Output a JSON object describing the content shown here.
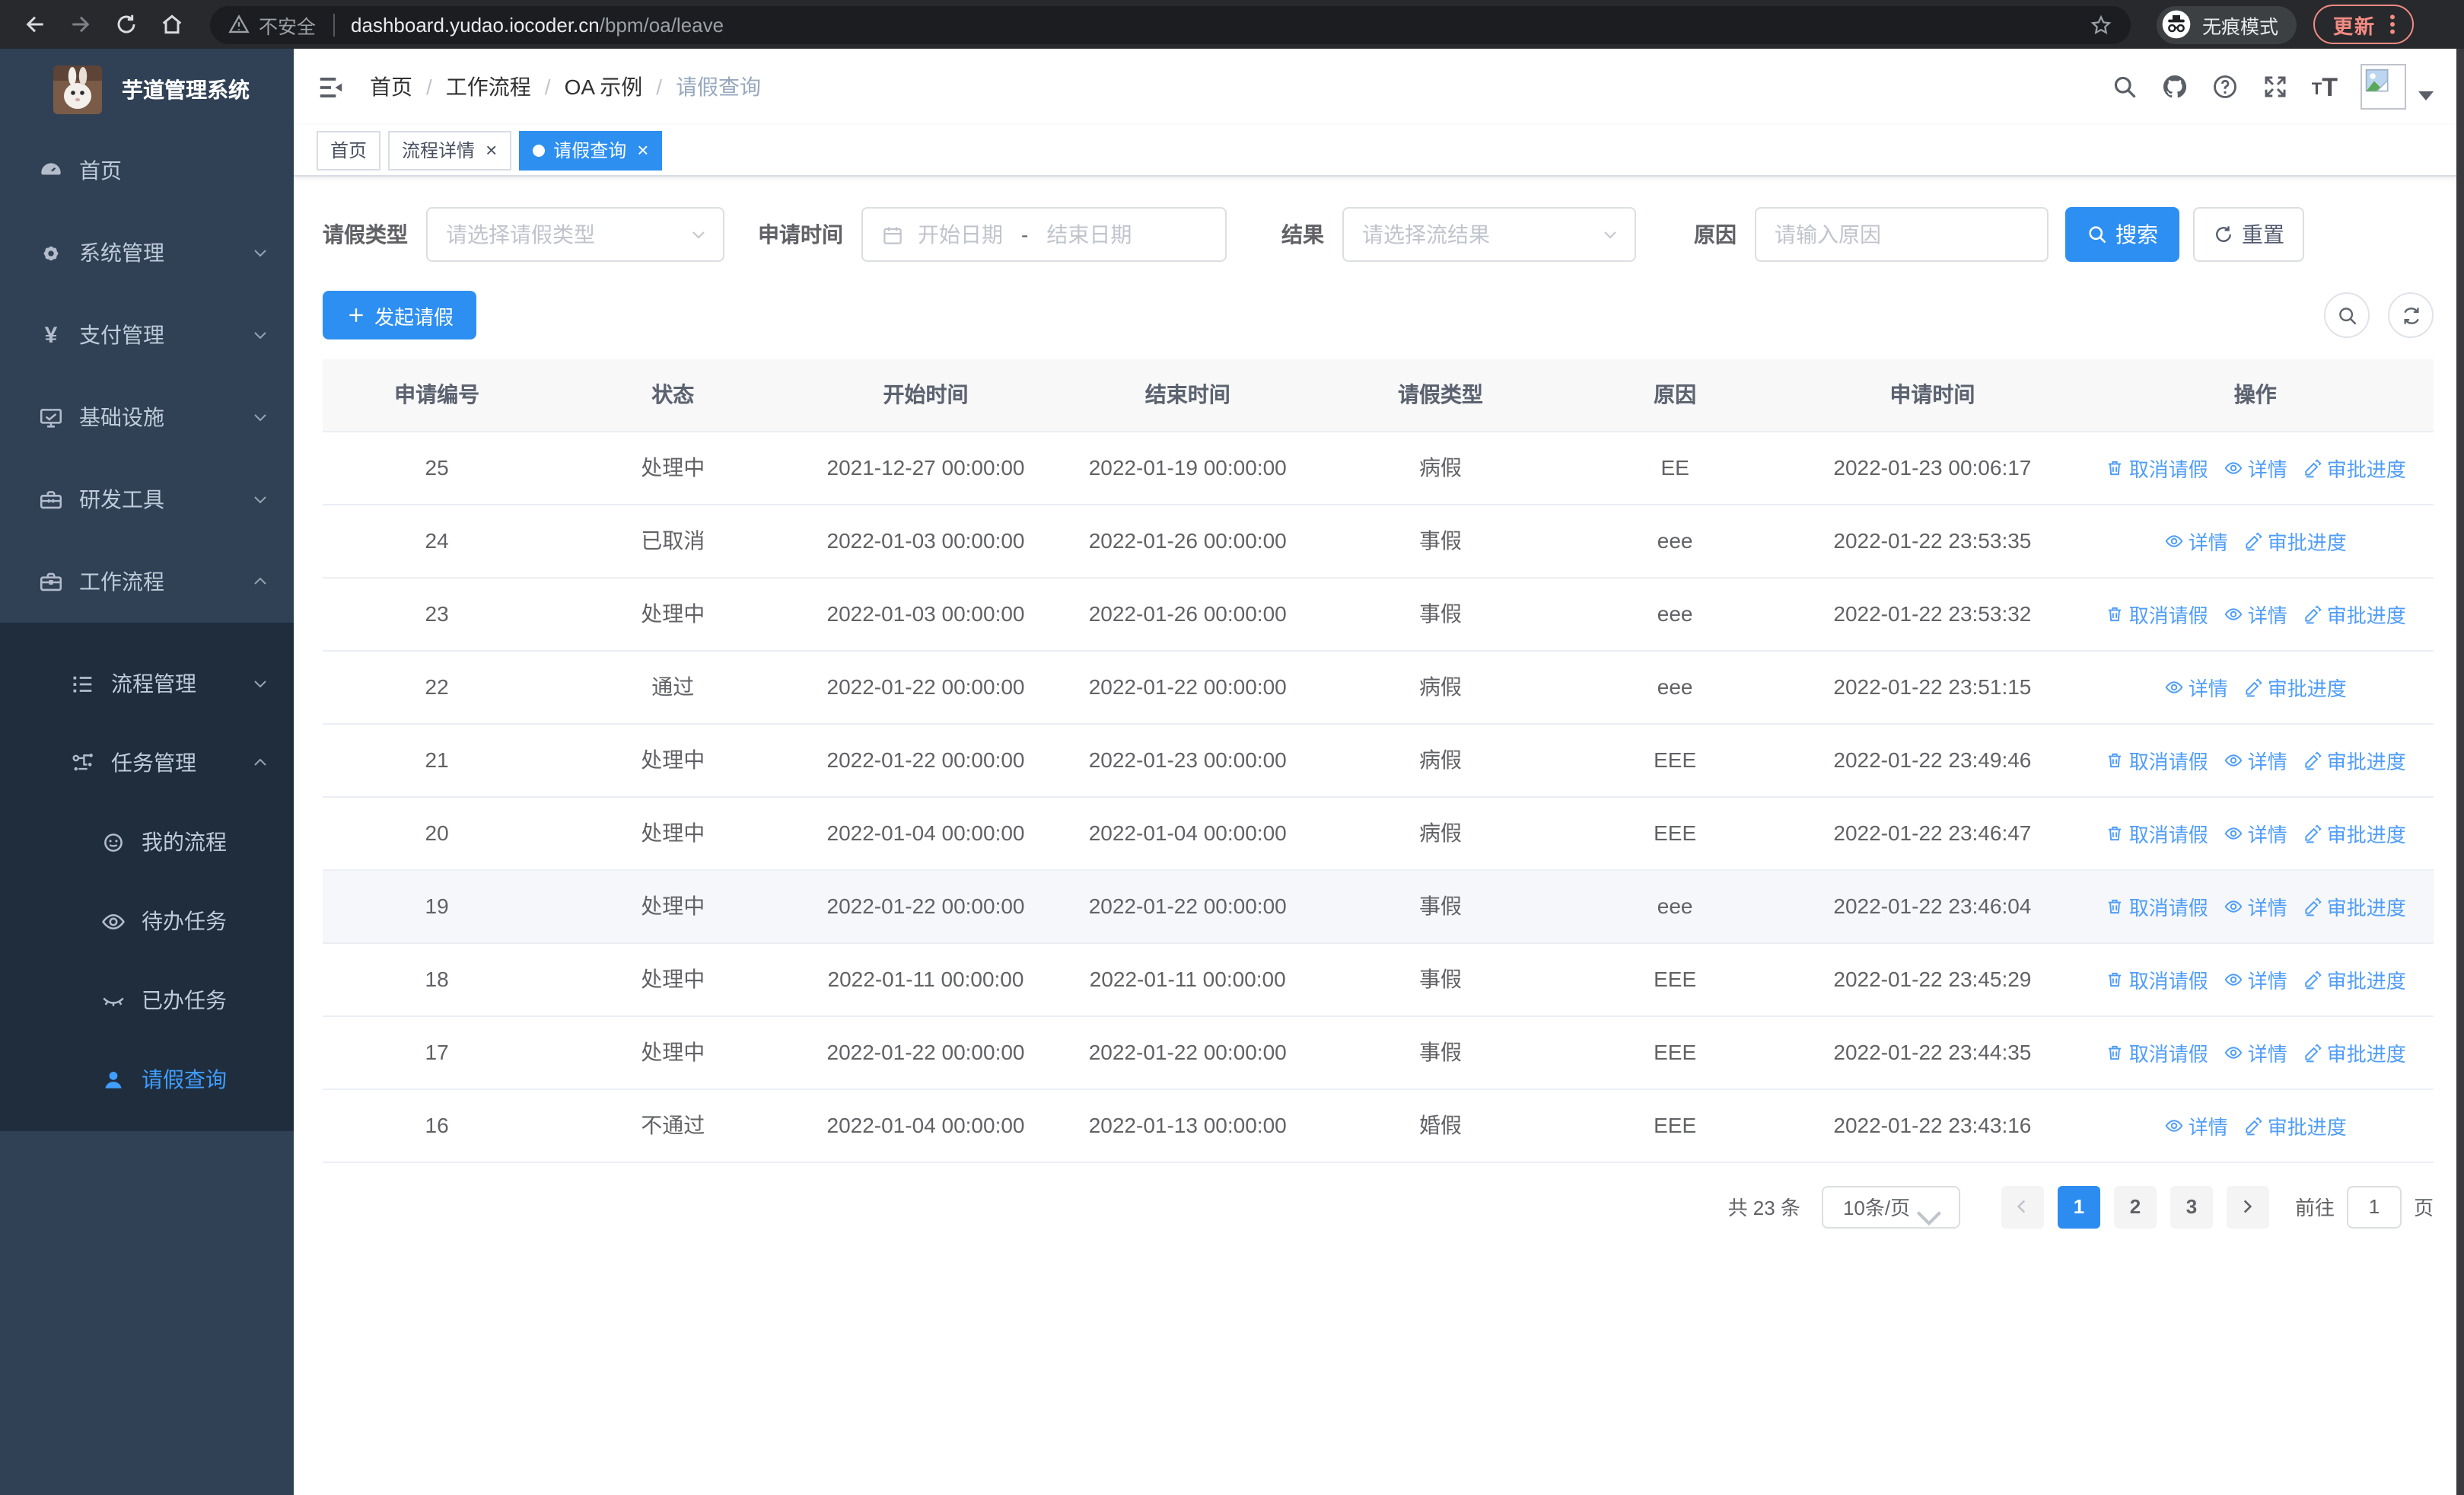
{
  "colors": {
    "primary": "#2d8ff0",
    "link": "#4f9df8",
    "sidebar_bg": "#304156",
    "sidebar_submenu_bg": "#1f2d3d",
    "sidebar_active": "#409eff"
  },
  "browser": {
    "security_label": "不安全",
    "url_host": "dashboard.yudao.iocoder.cn",
    "url_path": "/bpm/oa/leave",
    "incognito_label": "无痕模式",
    "update_label": "更新"
  },
  "sidebar": {
    "title": "芋道管理系统",
    "items": [
      {
        "label": "首页"
      },
      {
        "label": "系统管理"
      },
      {
        "label": "支付管理"
      },
      {
        "label": "基础设施"
      },
      {
        "label": "研发工具"
      },
      {
        "label": "工作流程"
      }
    ],
    "submenu": [
      {
        "label": "流程管理"
      },
      {
        "label": "任务管理"
      },
      {
        "label": "我的流程"
      },
      {
        "label": "待办任务"
      },
      {
        "label": "已办任务"
      },
      {
        "label": "请假查询"
      }
    ]
  },
  "header": {
    "breadcrumb": [
      "首页",
      "工作流程",
      "OA 示例",
      "请假查询"
    ],
    "separator": "/"
  },
  "tabs": {
    "close_glyph": "×",
    "items": [
      {
        "label": "首页"
      },
      {
        "label": "流程详情"
      },
      {
        "label": "请假查询"
      }
    ]
  },
  "filters": {
    "leave_type": {
      "label": "请假类型",
      "placeholder": "请选择请假类型"
    },
    "apply_time": {
      "label": "申请时间",
      "start_placeholder": "开始日期",
      "separator": "-",
      "end_placeholder": "结束日期"
    },
    "result": {
      "label": "结果",
      "placeholder": "请选择流结果"
    },
    "reason": {
      "label": "原因",
      "placeholder": "请输入原因"
    },
    "search_label": "搜索",
    "reset_label": "重置"
  },
  "toolbar": {
    "create_label": "发起请假"
  },
  "table": {
    "columns": [
      "申请编号",
      "状态",
      "开始时间",
      "结束时间",
      "请假类型",
      "原因",
      "申请时间",
      "操作"
    ],
    "column_keys": [
      "id",
      "status",
      "start",
      "end",
      "type",
      "reason",
      "applied"
    ],
    "actions_meta": {
      "cancel": {
        "label": "取消请假",
        "icon": "trash-icon"
      },
      "detail": {
        "label": "详情",
        "icon": "eye-icon"
      },
      "progress": {
        "label": "审批进度",
        "icon": "pen-icon"
      }
    },
    "rows": [
      {
        "id": "25",
        "status": "处理中",
        "start": "2021-12-27 00:00:00",
        "end": "2022-01-19 00:00:00",
        "type": "病假",
        "reason": "EE",
        "applied": "2022-01-23 00:06:17",
        "actions": [
          "cancel",
          "detail",
          "progress"
        ]
      },
      {
        "id": "24",
        "status": "已取消",
        "start": "2022-01-03 00:00:00",
        "end": "2022-01-26 00:00:00",
        "type": "事假",
        "reason": "eee",
        "applied": "2022-01-22 23:53:35",
        "actions": [
          "detail",
          "progress"
        ]
      },
      {
        "id": "23",
        "status": "处理中",
        "start": "2022-01-03 00:00:00",
        "end": "2022-01-26 00:00:00",
        "type": "事假",
        "reason": "eee",
        "applied": "2022-01-22 23:53:32",
        "actions": [
          "cancel",
          "detail",
          "progress"
        ]
      },
      {
        "id": "22",
        "status": "通过",
        "start": "2022-01-22 00:00:00",
        "end": "2022-01-22 00:00:00",
        "type": "病假",
        "reason": "eee",
        "applied": "2022-01-22 23:51:15",
        "actions": [
          "detail",
          "progress"
        ]
      },
      {
        "id": "21",
        "status": "处理中",
        "start": "2022-01-22 00:00:00",
        "end": "2022-01-23 00:00:00",
        "type": "病假",
        "reason": "EEE",
        "applied": "2022-01-22 23:49:46",
        "actions": [
          "cancel",
          "detail",
          "progress"
        ]
      },
      {
        "id": "20",
        "status": "处理中",
        "start": "2022-01-04 00:00:00",
        "end": "2022-01-04 00:00:00",
        "type": "病假",
        "reason": "EEE",
        "applied": "2022-01-22 23:46:47",
        "actions": [
          "cancel",
          "detail",
          "progress"
        ]
      },
      {
        "id": "19",
        "status": "处理中",
        "start": "2022-01-22 00:00:00",
        "end": "2022-01-22 00:00:00",
        "type": "事假",
        "reason": "eee",
        "applied": "2022-01-22 23:46:04",
        "actions": [
          "cancel",
          "detail",
          "progress"
        ],
        "highlighted": true
      },
      {
        "id": "18",
        "status": "处理中",
        "start": "2022-01-11 00:00:00",
        "end": "2022-01-11 00:00:00",
        "type": "事假",
        "reason": "EEE",
        "applied": "2022-01-22 23:45:29",
        "actions": [
          "cancel",
          "detail",
          "progress"
        ]
      },
      {
        "id": "17",
        "status": "处理中",
        "start": "2022-01-22 00:00:00",
        "end": "2022-01-22 00:00:00",
        "type": "事假",
        "reason": "EEE",
        "applied": "2022-01-22 23:44:35",
        "actions": [
          "cancel",
          "detail",
          "progress"
        ]
      },
      {
        "id": "16",
        "status": "不通过",
        "start": "2022-01-04 00:00:00",
        "end": "2022-01-13 00:00:00",
        "type": "婚假",
        "reason": "EEE",
        "applied": "2022-01-22 23:43:16",
        "actions": [
          "detail",
          "progress"
        ]
      }
    ]
  },
  "pagination": {
    "total_label": "共 23 条",
    "page_size_label": "10条/页",
    "pages": [
      "1",
      "2",
      "3"
    ],
    "active_page": "1",
    "goto_label": "前往",
    "goto_value": "1",
    "page_unit": "页"
  }
}
